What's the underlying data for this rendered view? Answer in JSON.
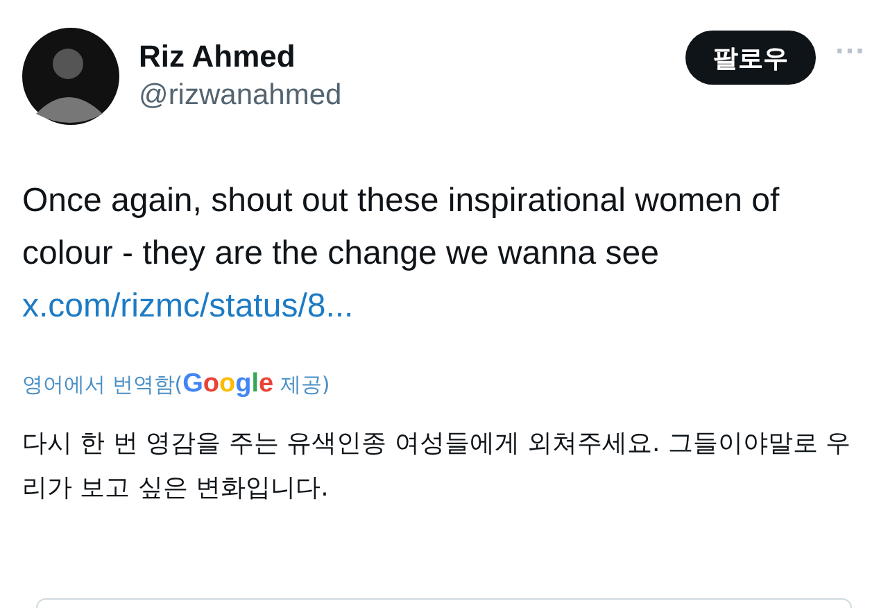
{
  "author": {
    "name": "Riz Ahmed",
    "handle": "@rizwanahmed"
  },
  "follow_button": {
    "label": "팔로우"
  },
  "more_button": {
    "label": "···"
  },
  "tweet": {
    "text": "Once again, shout out these inspirational women of colour - they are the change we wanna see",
    "link": "x.com/rizmc/status/8..."
  },
  "translation": {
    "prefix": "영어에서 번역함(",
    "provider": "Google",
    "suffix": " 제공)",
    "text": "다시 한 번 영감을 주는 유색인종 여성들에게 외쳐주세요. 그들이야말로 우리가 보고 싶은 변화입니다."
  }
}
